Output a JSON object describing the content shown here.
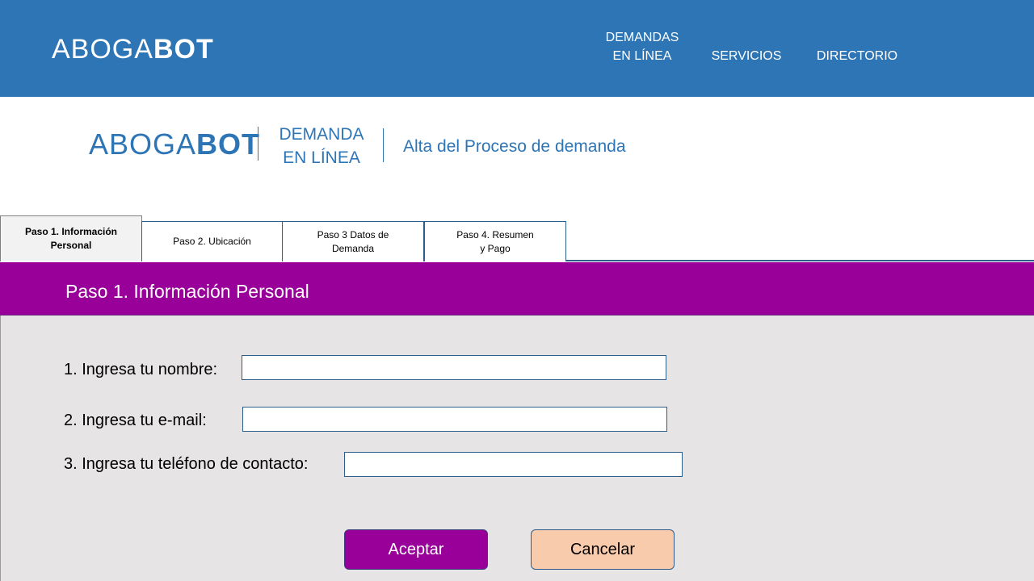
{
  "topbar": {
    "logo_light": "ABOGA",
    "logo_bold": "BOT",
    "nav": {
      "demandas_line1": "DEMANDAS",
      "demandas_line2": "EN LÍNEA",
      "servicios": "SERVICIOS",
      "directorio": "DIRECTORIO"
    }
  },
  "subheader": {
    "logo_light": "ABOGA",
    "logo_bold": "BOT",
    "demanda_line1": "DEMANDA",
    "demanda_line2": "EN LÍNEA",
    "process_title": "Alta del Proceso de demanda"
  },
  "tabs": [
    {
      "label": "Paso 1. Información\n        Personal",
      "active": true
    },
    {
      "label": "Paso 2. Ubicación",
      "active": false
    },
    {
      "label": "Paso 3 Datos de\n            Demanda",
      "active": false
    },
    {
      "label": "Paso 4. Resumen\n        y Pago",
      "active": false
    }
  ],
  "panel": {
    "title": "Paso 1.  Información Personal"
  },
  "form": {
    "name_label": "1. Ingresa tu nombre:",
    "name_value": "",
    "email_label": "2. Ingresa tu e-mail:",
    "email_value": "",
    "phone_label": "3. Ingresa tu teléfono de contacto:",
    "phone_value": ""
  },
  "buttons": {
    "accept": "Aceptar",
    "cancel": "Cancelar"
  },
  "colors": {
    "brand_blue": "#2e75b6",
    "accent_purple": "#990099",
    "panel_gray": "#e6e4e5",
    "cancel_peach": "#f8cbad"
  }
}
